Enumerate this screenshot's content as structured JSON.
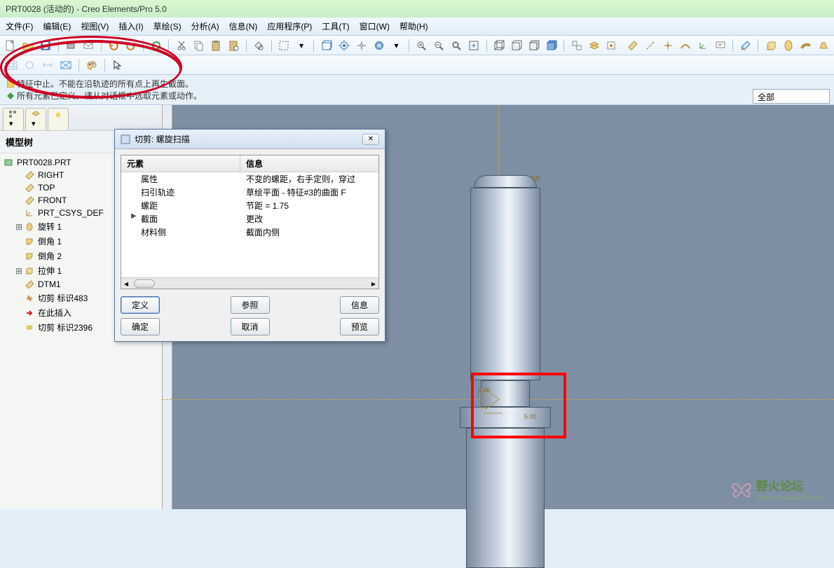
{
  "app": {
    "title": "PRT0028 (活动的) - Creo Elements/Pro 5.0"
  },
  "menu": [
    "文件(F)",
    "编辑(E)",
    "视图(V)",
    "插入(I)",
    "草绘(S)",
    "分析(A)",
    "信息(N)",
    "应用程序(P)",
    "工具(T)",
    "窗口(W)",
    "帮助(H)"
  ],
  "messages": [
    "特征中止。不能在沿轨迹的所有点上再生截面。",
    "所有元素已定义。请从对话框中选取元素或动作。"
  ],
  "filter": {
    "value": "全部"
  },
  "sidebar": {
    "title": "模型树",
    "root": "PRT0028.PRT",
    "items": [
      {
        "label": "RIGHT",
        "icon": "datum"
      },
      {
        "label": "TOP",
        "icon": "datum"
      },
      {
        "label": "FRONT",
        "icon": "datum"
      },
      {
        "label": "PRT_CSYS_DEF",
        "icon": "csys"
      },
      {
        "label": "旋转 1",
        "icon": "revolve",
        "exp": "+"
      },
      {
        "label": "倒角 1",
        "icon": "chamfer"
      },
      {
        "label": "倒角 2",
        "icon": "chamfer"
      },
      {
        "label": "拉伸 1",
        "icon": "extrude",
        "exp": "+"
      },
      {
        "label": "DTM1",
        "icon": "datum"
      },
      {
        "label": "切剪 标识483",
        "icon": "cut"
      },
      {
        "label": "在此插入",
        "icon": "insert"
      },
      {
        "label": "切剪 标识2396",
        "icon": "cut2"
      }
    ]
  },
  "dialog": {
    "title": "切剪: 螺旋扫描",
    "col1": "元素",
    "col2": "信息",
    "rows": [
      {
        "el": "属性",
        "info": "不变的螺距，右手定则，穿过"
      },
      {
        "el": "扫引轨迹",
        "info": "草绘平面 - 特征#3的曲面 F"
      },
      {
        "el": "螺距",
        "info": "节距 = 1.75"
      },
      {
        "el": "截面",
        "info": "更改",
        "arrow": true
      },
      {
        "el": "材料侧",
        "info": "截面内侧"
      }
    ],
    "btns": {
      "define": "定义",
      "ok": "确定",
      "ref": "参照",
      "cancel": "取消",
      "info": "信息",
      "preview": "预览"
    }
  },
  "viewport": {
    "top_label": "TOP",
    "dim1": "2.00",
    "dim2": "5.00"
  },
  "watermark": {
    "name": "野火论坛",
    "url": "www.proewildfire.cn"
  }
}
